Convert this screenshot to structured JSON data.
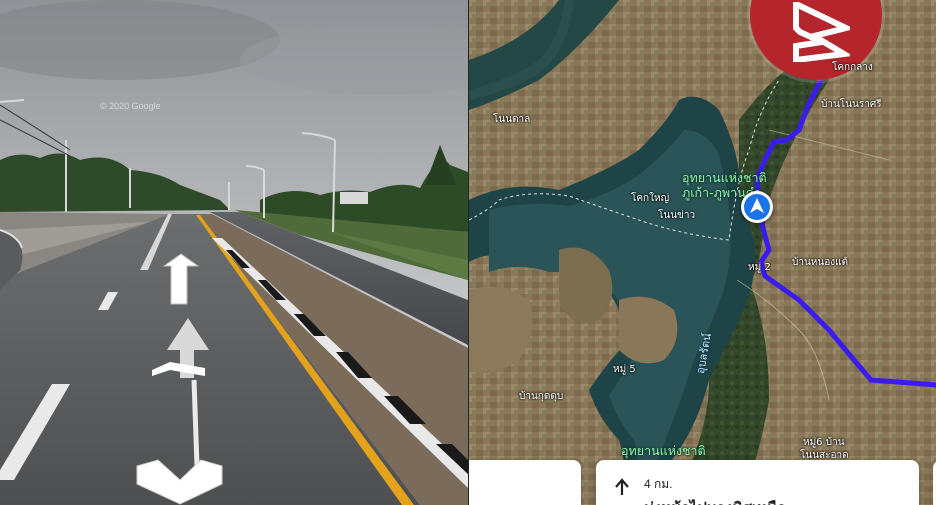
{
  "street_view": {
    "watermark": "© 2020 Google"
  },
  "map": {
    "place_labels": [
      {
        "id": "khok-klang",
        "text": "โคกกลาง"
      },
      {
        "id": "ban-non-rat-si",
        "text": "บ้านโนนราศรี"
      },
      {
        "id": "non-tan",
        "text": "โนนตาล"
      },
      {
        "id": "khok-yai",
        "text": "โคกใหญ่"
      },
      {
        "id": "non-khao",
        "text": "โนนข่าว"
      },
      {
        "id": "mu-2",
        "text": "หมู่ 2"
      },
      {
        "id": "ban-nong-sae",
        "text": "บ้านหนองแต้"
      },
      {
        "id": "mu-5",
        "text": "หมู่ 5"
      },
      {
        "id": "ban-kut-dup",
        "text": "บ้านกุดดุบ"
      },
      {
        "id": "mu-6-ban",
        "text": "หมู่6 บ้าน"
      },
      {
        "id": "non-sa-at",
        "text": "โนนสะอาด"
      }
    ],
    "park_label_line1": "อุทยานแห่งชาติ",
    "park_label_line2": "ภูเก้า-ภูพานคำ",
    "park_label_bottom": "อุทยานแห่งชาติ",
    "water_label": "อุบลรัตน์",
    "colors": {
      "route": "#3a1cf0",
      "nav_arrow": "#1a73e8",
      "park_text": "#8cf2b0",
      "logo_badge": "#b4262c"
    }
  },
  "navigation": {
    "step_icon": "arrow-up-icon",
    "distance": "4 กม.",
    "instruction": "มุ่งหน้าไปทางทิศเหนือ"
  },
  "logo": {
    "icon": "brand-logo-icon"
  }
}
